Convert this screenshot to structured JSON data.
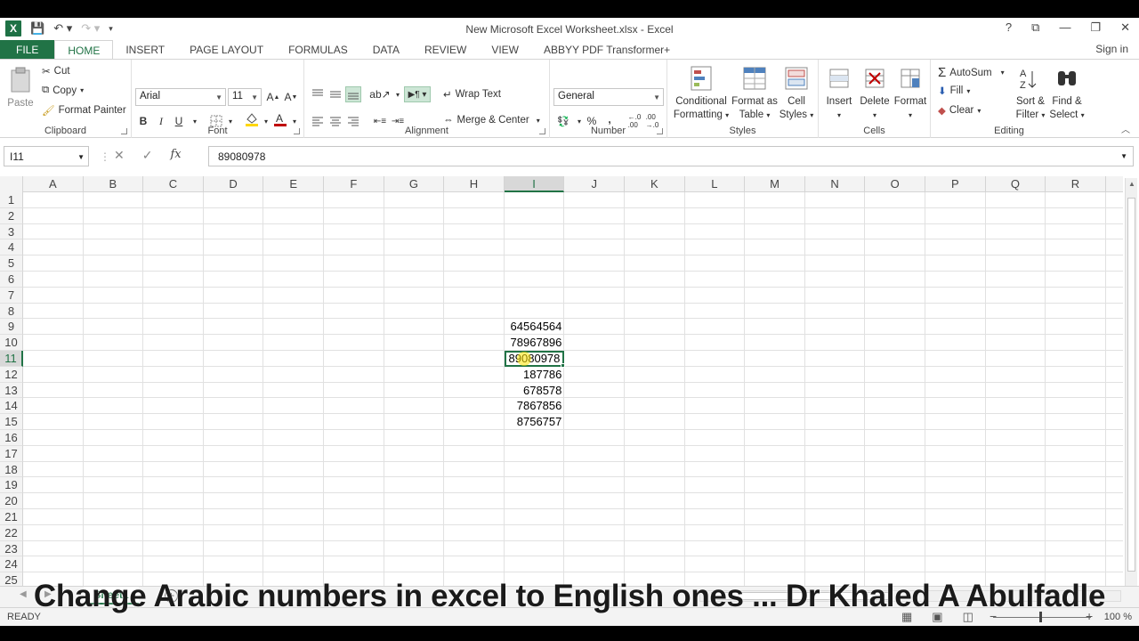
{
  "window": {
    "title": "New Microsoft Excel Worksheet.xlsx - Excel",
    "help": "?",
    "controls": [
      "⧉",
      "—",
      "❐",
      "✕"
    ]
  },
  "tabs": [
    "FILE",
    "HOME",
    "INSERT",
    "PAGE LAYOUT",
    "FORMULAS",
    "DATA",
    "REVIEW",
    "VIEW",
    "ABBYY PDF Transformer+"
  ],
  "signin": "Sign in",
  "ribbon": {
    "clipboard": {
      "label": "Clipboard",
      "paste": "Paste",
      "cut": "Cut",
      "copy": "Copy",
      "format_painter": "Format Painter"
    },
    "font": {
      "label": "Font",
      "family": "Arial",
      "size": "11",
      "bold": "B",
      "italic": "I",
      "underline": "U"
    },
    "alignment": {
      "label": "Alignment",
      "wrap_text": "Wrap Text",
      "merge_center": "Merge & Center"
    },
    "number": {
      "label": "Number",
      "format": "General",
      "percent": "%",
      "comma": ","
    },
    "styles": {
      "label": "Styles",
      "conditional_1": "Conditional",
      "conditional_2": "Formatting",
      "format_table_1": "Format as",
      "format_table_2": "Table",
      "cell_styles_1": "Cell",
      "cell_styles_2": "Styles"
    },
    "cells": {
      "label": "Cells",
      "insert": "Insert",
      "delete": "Delete",
      "format": "Format"
    },
    "editing": {
      "label": "Editing",
      "autosum": "AutoSum",
      "fill": "Fill",
      "clear": "Clear",
      "sort_1": "Sort &",
      "sort_2": "Filter",
      "find_1": "Find &",
      "find_2": "Select"
    }
  },
  "formula_bar": {
    "name_box": "I11",
    "fx": "fx",
    "value": "89080978"
  },
  "columns": [
    "A",
    "B",
    "C",
    "D",
    "E",
    "F",
    "G",
    "H",
    "I",
    "J",
    "K",
    "L",
    "M",
    "N",
    "O",
    "P",
    "Q",
    "R"
  ],
  "rows": [
    "1",
    "2",
    "3",
    "4",
    "5",
    "6",
    "7",
    "8",
    "9",
    "10",
    "11",
    "12",
    "13",
    "14",
    "15",
    "16",
    "17",
    "18",
    "19",
    "20",
    "21",
    "22",
    "23",
    "24",
    "25"
  ],
  "cells_i": [
    {
      "row": "9",
      "value": "64564564"
    },
    {
      "row": "10",
      "value": "78967896"
    },
    {
      "row": "11",
      "value": "89080978"
    },
    {
      "row": "12",
      "value": "187786"
    },
    {
      "row": "13",
      "value": "678578"
    },
    {
      "row": "14",
      "value": "7867856"
    },
    {
      "row": "15",
      "value": "8756757"
    }
  ],
  "sheet_tab": "Sheet1",
  "status": {
    "ready": "READY",
    "zoom": "100 %"
  },
  "caption": "Change Arabic numbers in excel to English ones ... Dr Khaled A Abulfadle",
  "colors": {
    "accent": "#217346",
    "fill_yellow": "#ffd700",
    "font_red": "#c00000"
  }
}
